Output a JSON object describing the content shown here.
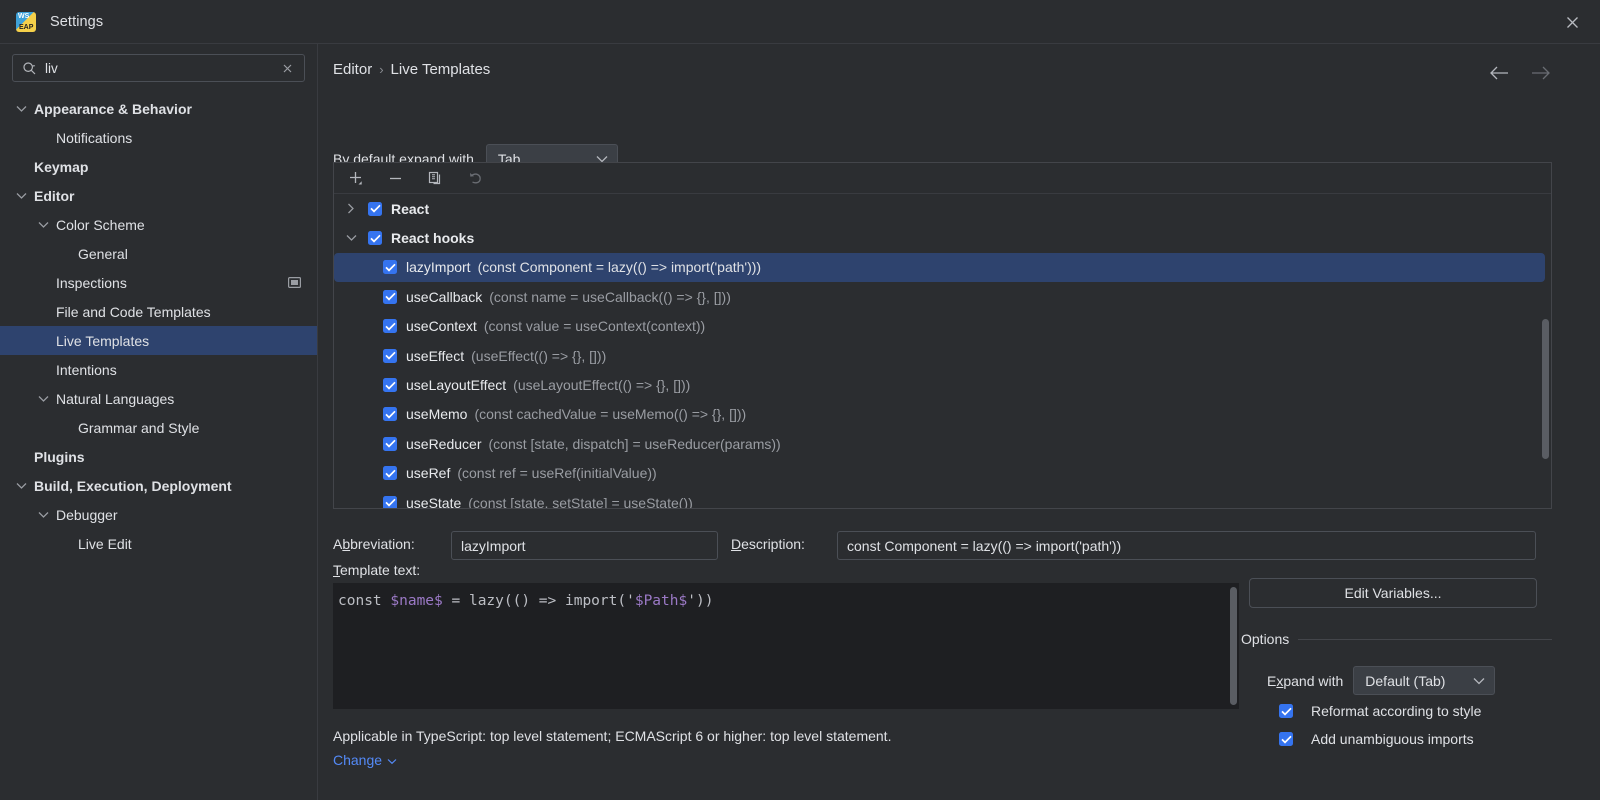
{
  "window": {
    "title": "Settings",
    "app_icon": "webstorm-icon",
    "close_icon": "close-icon"
  },
  "search": {
    "value": "liv",
    "placeholder": "",
    "icon": "search-icon",
    "clear_icon": "clear-icon"
  },
  "sidebar": {
    "items": [
      {
        "label": "Appearance & Behavior",
        "indent": 0,
        "chevron": "expanded",
        "bold": true,
        "selected": false,
        "trailing_icon": ""
      },
      {
        "label": "Notifications",
        "indent": 1,
        "chevron": "none",
        "bold": false,
        "selected": false,
        "trailing_icon": ""
      },
      {
        "label": "Keymap",
        "indent": 0,
        "chevron": "none",
        "bold": true,
        "selected": false,
        "trailing_icon": ""
      },
      {
        "label": "Editor",
        "indent": 0,
        "chevron": "expanded",
        "bold": true,
        "selected": false,
        "trailing_icon": ""
      },
      {
        "label": "Color Scheme",
        "indent": 1,
        "chevron": "expanded",
        "bold": false,
        "selected": false,
        "trailing_icon": ""
      },
      {
        "label": "General",
        "indent": 2,
        "chevron": "none",
        "bold": false,
        "selected": false,
        "trailing_icon": ""
      },
      {
        "label": "Inspections",
        "indent": 1,
        "chevron": "none",
        "bold": false,
        "selected": false,
        "trailing_icon": "window-icon"
      },
      {
        "label": "File and Code Templates",
        "indent": 1,
        "chevron": "none",
        "bold": false,
        "selected": false,
        "trailing_icon": ""
      },
      {
        "label": "Live Templates",
        "indent": 1,
        "chevron": "none",
        "bold": false,
        "selected": true,
        "trailing_icon": ""
      },
      {
        "label": "Intentions",
        "indent": 1,
        "chevron": "none",
        "bold": false,
        "selected": false,
        "trailing_icon": ""
      },
      {
        "label": "Natural Languages",
        "indent": 1,
        "chevron": "expanded",
        "bold": false,
        "selected": false,
        "trailing_icon": ""
      },
      {
        "label": "Grammar and Style",
        "indent": 2,
        "chevron": "none",
        "bold": false,
        "selected": false,
        "trailing_icon": ""
      },
      {
        "label": "Plugins",
        "indent": 0,
        "chevron": "none",
        "bold": true,
        "selected": false,
        "trailing_icon": ""
      },
      {
        "label": "Build, Execution, Deployment",
        "indent": 0,
        "chevron": "expanded",
        "bold": true,
        "selected": false,
        "trailing_icon": ""
      },
      {
        "label": "Debugger",
        "indent": 1,
        "chevron": "expanded",
        "bold": false,
        "selected": false,
        "trailing_icon": ""
      },
      {
        "label": "Live Edit",
        "indent": 2,
        "chevron": "none",
        "bold": false,
        "selected": false,
        "trailing_icon": ""
      }
    ]
  },
  "breadcrumb": {
    "parent": "Editor",
    "separator": "›",
    "current": "Live Templates"
  },
  "nav": {
    "back_icon": "arrow-left-icon",
    "forward_icon": "arrow-right-icon"
  },
  "expand_default": {
    "label": "By default expand with",
    "value": "Tab",
    "chevron_icon": "chevron-down-icon"
  },
  "toolbar": {
    "add_icon": "plus-icon",
    "remove_icon": "minus-icon",
    "duplicate_icon": "copy-icon",
    "revert_icon": "undo-icon"
  },
  "templates": [
    {
      "chevron": "collapsed",
      "checked": true,
      "abbr": "React",
      "desc": "",
      "group": true,
      "selected": false
    },
    {
      "chevron": "expanded",
      "checked": true,
      "abbr": "React hooks",
      "desc": "",
      "group": true,
      "selected": false
    },
    {
      "chevron": "none",
      "checked": true,
      "abbr": "lazyImport",
      "desc": "(const Component = lazy(() => import('path')))",
      "group": false,
      "selected": true
    },
    {
      "chevron": "none",
      "checked": true,
      "abbr": "useCallback",
      "desc": "(const name = useCallback(() => {}, []))",
      "group": false,
      "selected": false
    },
    {
      "chevron": "none",
      "checked": true,
      "abbr": "useContext",
      "desc": "(const value = useContext(context))",
      "group": false,
      "selected": false
    },
    {
      "chevron": "none",
      "checked": true,
      "abbr": "useEffect",
      "desc": "(useEffect(() => {}, []))",
      "group": false,
      "selected": false
    },
    {
      "chevron": "none",
      "checked": true,
      "abbr": "useLayoutEffect",
      "desc": "(useLayoutEffect(() => {}, []))",
      "group": false,
      "selected": false
    },
    {
      "chevron": "none",
      "checked": true,
      "abbr": "useMemo",
      "desc": "(const cachedValue = useMemo(() => {}, []))",
      "group": false,
      "selected": false
    },
    {
      "chevron": "none",
      "checked": true,
      "abbr": "useReducer",
      "desc": "(const [state, dispatch] = useReducer(params))",
      "group": false,
      "selected": false
    },
    {
      "chevron": "none",
      "checked": true,
      "abbr": "useRef",
      "desc": "(const ref = useRef(initialValue))",
      "group": false,
      "selected": false
    },
    {
      "chevron": "none",
      "checked": true,
      "abbr": "useState",
      "desc": "(const [state, setState] = useState())",
      "group": false,
      "selected": false
    }
  ],
  "details": {
    "abbreviation_label_pre": "A",
    "abbreviation_label_mnemonic": "b",
    "abbreviation_label_post": "breviation:",
    "abbreviation_value": "lazyImport",
    "description_label_mnemonic": "D",
    "description_label_post": "escription:",
    "description_value": "const Component = lazy(() => import('path'))",
    "template_text_label_mnemonic": "T",
    "template_text_label_post": "emplate text:",
    "template_code_prefix": "const ",
    "template_code_var1": "$name$",
    "template_code_mid": " = lazy(() => import('",
    "template_code_var2": "$Path$",
    "template_code_suffix": "'))",
    "applicable_text": "Applicable in TypeScript: top level statement; ECMAScript 6 or higher: top level statement.",
    "change_label": "Change",
    "change_chevron_icon": "chevron-down-icon"
  },
  "options": {
    "edit_variables_label": "Edit Variables...",
    "section_title": "Options",
    "expand_with_label_pre": "E",
    "expand_with_label_mnemonic": "x",
    "expand_with_label_post": "pand with",
    "expand_with_value": "Default (Tab)",
    "reformat_label": "Reformat according to style",
    "reformat_checked": true,
    "imports_label": "Add unambiguous imports",
    "imports_checked": true
  },
  "colors": {
    "accent": "#3574f0",
    "selection": "#2e436e",
    "link": "#548af7",
    "background": "#2b2d30",
    "editor_background": "#1e1f22",
    "template_variable": "#9b79c6"
  }
}
